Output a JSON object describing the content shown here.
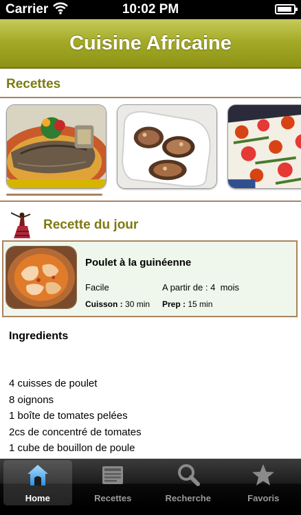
{
  "status_bar": {
    "carrier": "Carrier",
    "time": "10:02 PM"
  },
  "header": {
    "title": "Cuisine Africaine",
    "accent_color": "#a5ab27"
  },
  "recettes_section": {
    "heading": "Recettes",
    "thumbnails": [
      {
        "icon": "grilled-fish-photo"
      },
      {
        "icon": "stuffed-eggplant-photo"
      },
      {
        "icon": "tomato-dish-photo"
      }
    ]
  },
  "recette_du_jour": {
    "heading": "Recette du jour",
    "recipe": {
      "name": "Poulet à la guinéenne",
      "difficulty": "Facile",
      "age_label": "A partir de :",
      "age_value": "4",
      "age_unit": "mois",
      "cook_label": "Cuisson :",
      "cook_value": "30 min",
      "prep_label": "Prep :",
      "prep_value": "15 min"
    }
  },
  "ingredients": {
    "title": "Ingredients",
    "items": [
      "4 cuisses de poulet",
      "8 oignons",
      "1 boîte de tomates pelées",
      "2cs de concentré de tomates",
      "1 cube de bouillon de poule"
    ]
  },
  "tab_bar": {
    "tabs": [
      {
        "label": "Home",
        "icon": "home-icon",
        "active": true
      },
      {
        "label": "Recettes",
        "icon": "recipes-icon",
        "active": false
      },
      {
        "label": "Recherche",
        "icon": "search-icon",
        "active": false
      },
      {
        "label": "Favoris",
        "icon": "star-icon",
        "active": false
      }
    ]
  }
}
